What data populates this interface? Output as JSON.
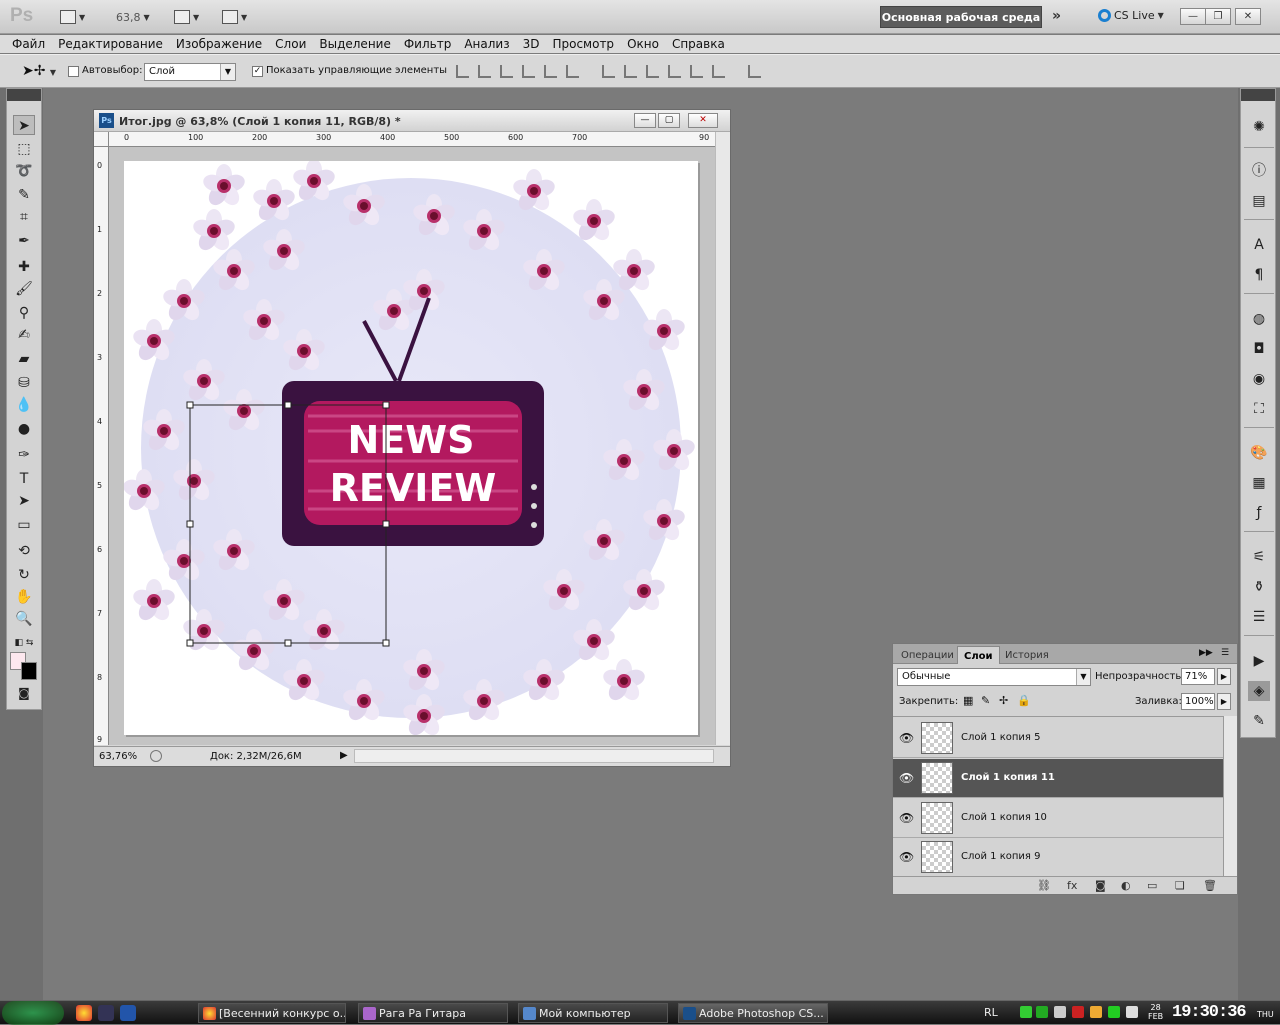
{
  "app": {
    "logo": "Ps",
    "zoom_value": "63,8",
    "workspace_label": "Основная рабочая среда",
    "cs_live_label": "CS Live"
  },
  "menu": [
    "Файл",
    "Редактирование",
    "Изображение",
    "Слои",
    "Выделение",
    "Фильтр",
    "Анализ",
    "3D",
    "Просмотр",
    "Окно",
    "Справка"
  ],
  "options": {
    "autoselect_label": "Автовыбор:",
    "autoselect_value": "Слой",
    "show_controls_label": "Показать управляющие элементы",
    "show_controls_checked": "✓"
  },
  "document": {
    "title": "Итог.jpg @ 63,8% (Слой 1 копия 11, RGB/8) *",
    "hruler": [
      "0",
      "100",
      "200",
      "300",
      "400",
      "500",
      "600",
      "700",
      "90"
    ],
    "vruler": [
      "0",
      "1",
      "2",
      "3",
      "4",
      "5",
      "6",
      "7",
      "8",
      "9"
    ],
    "zoom_status": "63,76%",
    "doc_status": "Док: 2,32M/26,6M",
    "artwork_line1": "NEWS",
    "artwork_line2": "REVIEW"
  },
  "layers_panel": {
    "tabs": [
      "Операции",
      "Слои",
      "История"
    ],
    "active_tab": "Слои",
    "blend_mode": "Обычные",
    "opacity_label": "Непрозрачность:",
    "opacity_value": "71%",
    "lock_label": "Закрепить:",
    "fill_label": "Заливка:",
    "fill_value": "100%",
    "layers": [
      {
        "name": "Слой 1 копия 5",
        "selected": false
      },
      {
        "name": "Слой 1 копия 11",
        "selected": true
      },
      {
        "name": "Слой 1 копия 10",
        "selected": false
      },
      {
        "name": "Слой 1 копия 9",
        "selected": false
      }
    ]
  },
  "taskbar": {
    "tasks": [
      "[Весенний конкурс о...",
      "Рага Ра Гитара",
      "Мой компьютер",
      "Adobe Photoshop CS..."
    ],
    "lang": "RL",
    "date_day": "28",
    "date_month": "FEB",
    "time": "19:30:36",
    "weekday": "THU"
  },
  "colors": {
    "accent_ps": "#1a4f8a",
    "tv_frame": "#3a1240",
    "tv_screen": "#b3195f",
    "blossom": "#e2dcf0",
    "blossom_center": "#8a1035"
  }
}
